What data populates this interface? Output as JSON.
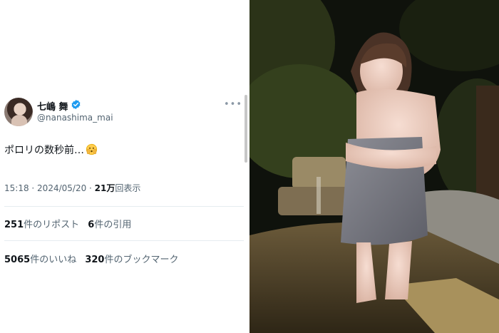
{
  "tweet": {
    "display_name": "七嶋 舞",
    "handle": "@nanashima_mai",
    "text": "ポロリの数秒前…",
    "time": "15:18",
    "separator1": " · ",
    "date": "2024/05/20",
    "separator2": " · ",
    "views_count": "21万",
    "views_label": "回表示",
    "reposts_count": "251",
    "reposts_label": "件のリポスト",
    "quotes_count": "6",
    "quotes_label": "件の引用",
    "likes_count": "5065",
    "likes_label": "件のいいね",
    "bookmarks_count": "320",
    "bookmarks_label": "件のブックマーク"
  },
  "icons": {
    "verified": "verified-badge-icon",
    "more": "more-options-icon",
    "emoji": "peeking-face-emoji-icon"
  },
  "colors": {
    "verified_blue": "#1d9bf0",
    "text_primary": "#0f1419",
    "text_secondary": "#536471",
    "divider": "#e6ecf0"
  }
}
